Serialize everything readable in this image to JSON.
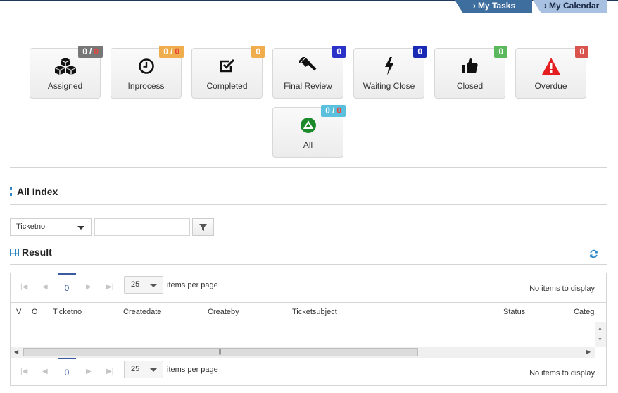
{
  "nav": {
    "tasks_label": "My Tasks",
    "calendar_label": "My Calendar",
    "chevron": "›"
  },
  "cards": [
    {
      "label": "Assigned",
      "badge_a": "0",
      "badge_sep": "/",
      "badge_b": "0",
      "badge_color": "#777777",
      "icon": "cubes-icon"
    },
    {
      "label": "Inprocess",
      "badge_a": "0",
      "badge_sep": "/",
      "badge_b": "0",
      "badge_color": "#f0ad4e",
      "icon": "clock-icon"
    },
    {
      "label": "Completed",
      "badge_a": "0",
      "badge_color": "#f0ad4e",
      "icon": "check-square-icon"
    },
    {
      "label": "Final Review",
      "badge_a": "0",
      "badge_color": "#2a32c8",
      "icon": "gavel-icon"
    },
    {
      "label": "Waiting Close",
      "badge_a": "0",
      "badge_color": "#1a2ab4",
      "icon": "bolt-icon"
    },
    {
      "label": "Closed",
      "badge_a": "0",
      "badge_color": "#5cb85c",
      "icon": "thumbs-up-icon"
    },
    {
      "label": "Overdue",
      "badge_a": "0",
      "badge_color": "#d9534f",
      "icon": "warning-icon"
    },
    {
      "label": "All",
      "badge_a": "0",
      "badge_sep": "/",
      "badge_b": "0",
      "badge_color": "#5bc0de",
      "icon": "up-circle-icon"
    }
  ],
  "index": {
    "title": "All Index"
  },
  "filter": {
    "field_selected": "Ticketno",
    "search_value": ""
  },
  "result": {
    "title": "Result"
  },
  "pager": {
    "page": "0",
    "page_size": "25",
    "items_per_page": "items per page",
    "info": "No items to display"
  },
  "columns": [
    "V",
    "O",
    "Ticketno",
    "Createdate",
    "Createby",
    "Ticketsubject",
    "Status",
    "Categ"
  ],
  "colors": {
    "nav_active": "#3e6e9e",
    "nav_secondary": "#a9c1e0",
    "accent": "#2a86c9",
    "pager_active": "#3a5ba0"
  }
}
